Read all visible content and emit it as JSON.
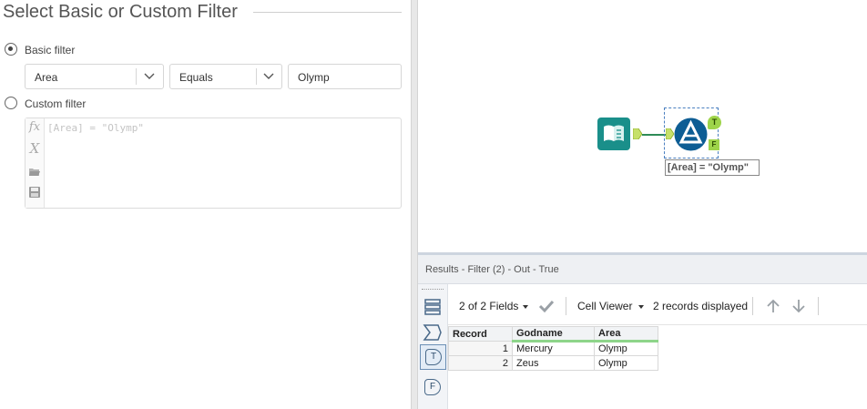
{
  "config": {
    "title": "Select Basic or Custom Filter",
    "basic": {
      "label": "Basic filter",
      "selected": true,
      "field": "Area",
      "operator": "Equals",
      "value": "Olymp"
    },
    "custom": {
      "label": "Custom filter",
      "selected": false,
      "expression": "[Area] = \"Olymp\"",
      "gutter_icons": [
        "fx-icon",
        "variable-x-icon",
        "open-folder-icon",
        "save-icon"
      ],
      "fx_glyph": "fx",
      "x_glyph": "X"
    }
  },
  "canvas": {
    "input_tool": "input-data-book-icon",
    "filter_tool": "filter-tool-icon",
    "true_anchor": "T",
    "false_anchor": "F",
    "annotation": "[Area] = \"Olymp\""
  },
  "results": {
    "title": "Results - Filter (2) - Out - True",
    "fields_label": "2 of 2 Fields",
    "viewer_label": "Cell Viewer",
    "records_label": "2 records displayed",
    "side_icons": [
      "table-rows-icon",
      "summation-icon",
      "true-output-icon",
      "false-output-icon"
    ],
    "side_true": "T",
    "side_false": "F",
    "table": {
      "headers": [
        "Record",
        "Godname",
        "Area"
      ],
      "rows": [
        {
          "record": "1",
          "godname": "Mercury",
          "area": "Olymp"
        },
        {
          "record": "2",
          "godname": "Zeus",
          "area": "Olymp"
        }
      ]
    }
  },
  "colors": {
    "accent_teal": "#1a8f8a",
    "filter_blue": "#0d5d94",
    "anchor_green": "#9ed44a",
    "header_green": "#8ed58a"
  }
}
